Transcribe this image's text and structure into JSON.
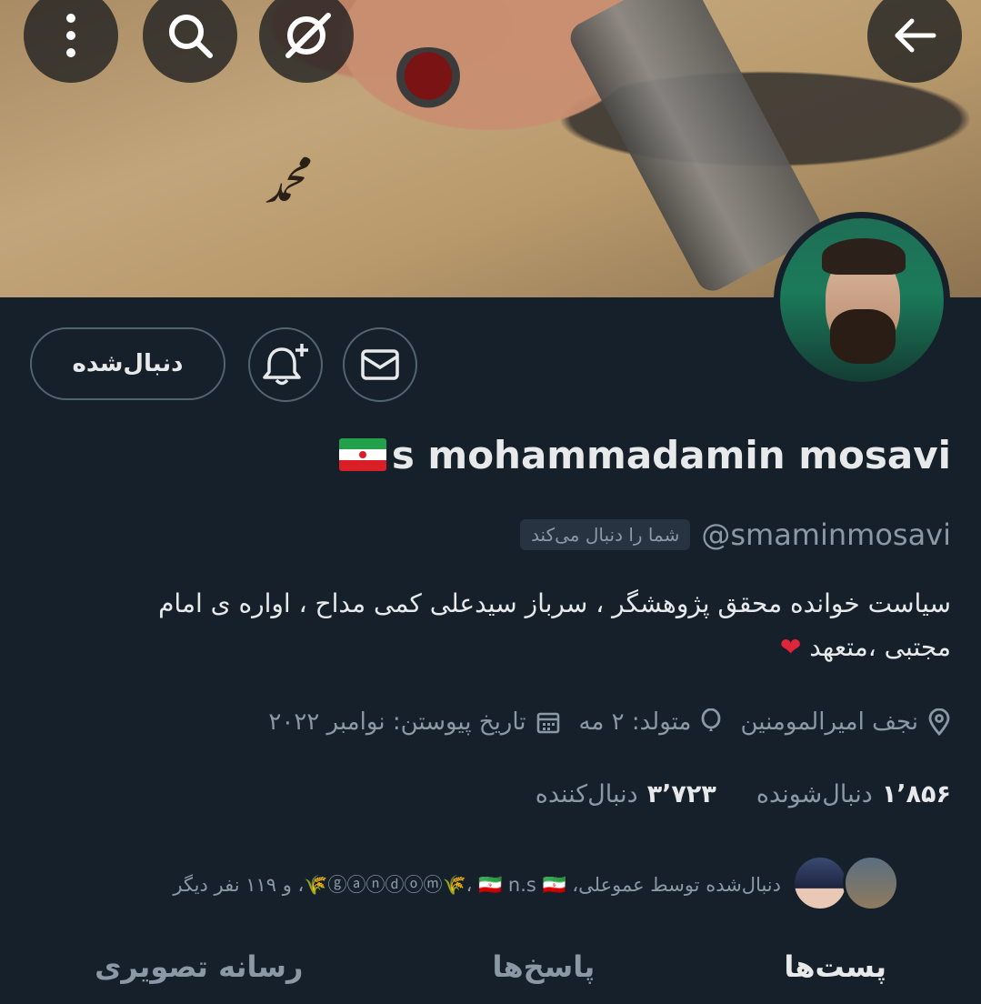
{
  "header": {
    "back_icon": "arrow-left-icon",
    "hide_icon": "eye-off-icon",
    "search_icon": "search-icon",
    "more_icon": "more-vertical-icon"
  },
  "profile": {
    "display_name": "s mohammadamin mosavi",
    "handle": "@smaminmosavi",
    "follows_you": "شما را دنبال می‌کند",
    "bio_line1": "سیاست خوانده محقق پژوهشگر  ، سرباز سیدعلی کمی مداح ، اواره ی امام",
    "bio_line2": "مجتبی ،متعهد",
    "location": "نجف امیرالمومنین",
    "birth": "متولد: ۲ مه",
    "joined": "تاریخ پیوستن: نوامبر ۲۰۲۲",
    "following_count": "۱٬۸۵۶",
    "following_label": "دنبال‌شونده",
    "followers_count": "۳٬۷۲۳",
    "followers_label": "دنبال‌کننده",
    "followed_by_text": "دنبال‌شده توسط عموعلی، ⓖⓐⓝⓓⓞⓜ🌾، 🇮🇷 n.s 🇮🇷🌾، و ۱۱۹ نفر دیگر"
  },
  "actions": {
    "following_label": "دنبال‌شده",
    "notify_icon": "bell-plus-icon",
    "message_icon": "envelope-icon"
  },
  "tabs": [
    {
      "label": "پست‌ها"
    },
    {
      "label": "پاسخ‌ها"
    },
    {
      "label": "رسانه تصویری"
    }
  ],
  "colors": {
    "background": "#15202b",
    "text_secondary": "#8b98a5",
    "border": "#536471"
  }
}
